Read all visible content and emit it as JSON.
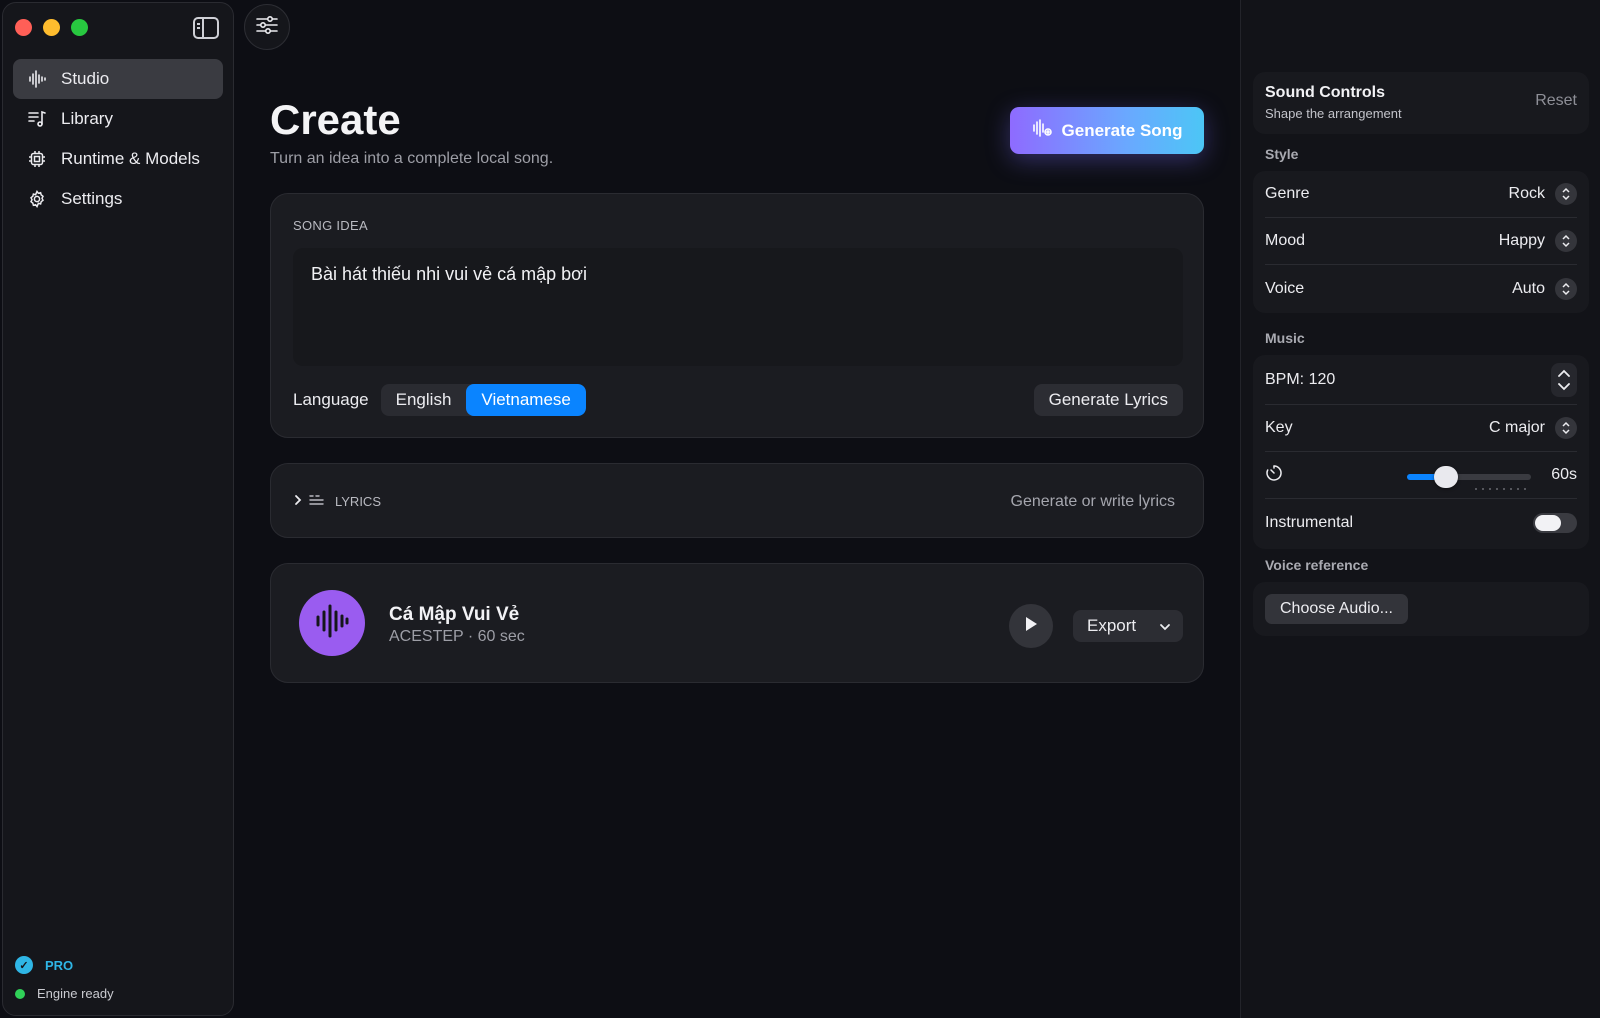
{
  "sidebar": {
    "items": [
      {
        "label": "Studio",
        "icon": "waveform-icon",
        "active": true
      },
      {
        "label": "Library",
        "icon": "music-list-icon",
        "active": false
      },
      {
        "label": "Runtime & Models",
        "icon": "cpu-icon",
        "active": false
      },
      {
        "label": "Settings",
        "icon": "gear-icon",
        "active": false
      }
    ],
    "pro_label": "PRO",
    "engine_status": "Engine ready"
  },
  "header": {
    "title": "Create",
    "subtitle": "Turn an idea into a complete local song.",
    "generate_song_label": "Generate Song"
  },
  "song_idea": {
    "section_label": "SONG IDEA",
    "value": "Bài hát thiếu nhi vui vẻ cá mập bơi",
    "language_label": "Language",
    "languages": [
      "English",
      "Vietnamese"
    ],
    "selected_language": "Vietnamese",
    "generate_lyrics_label": "Generate Lyrics"
  },
  "lyrics": {
    "section_label": "LYRICS",
    "hint": "Generate or write lyrics"
  },
  "track": {
    "title": "Cá Mập Vui Vẻ",
    "meta": "ACESTEP · 60 sec",
    "export_label": "Export"
  },
  "sound_controls": {
    "title": "Sound Controls",
    "subtitle": "Shape the arrangement",
    "reset_label": "Reset",
    "style_label": "Style",
    "genre_label": "Genre",
    "genre_value": "Rock",
    "mood_label": "Mood",
    "mood_value": "Happy",
    "voice_label": "Voice",
    "voice_value": "Auto",
    "music_label": "Music",
    "bpm_text": "BPM: 120",
    "key_label": "Key",
    "key_value": "C major",
    "duration_value": "60s",
    "duration_fraction": 0.25,
    "instrumental_label": "Instrumental",
    "instrumental_on": false,
    "voice_reference_label": "Voice reference",
    "choose_audio_label": "Choose Audio..."
  },
  "colors": {
    "accent": "#0a84ff",
    "avatar": "#9a5cf0",
    "pro": "#2fb6e6",
    "engine_ok": "#30d158"
  }
}
